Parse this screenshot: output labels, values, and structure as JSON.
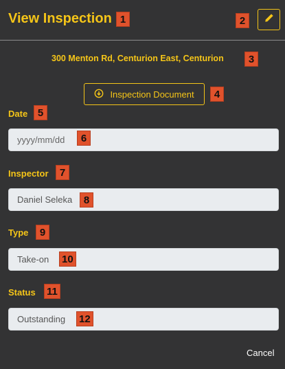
{
  "header": {
    "title": "View Inspection",
    "accent_color": "#F5C518",
    "edit_icon": "pencil-icon"
  },
  "address": "300 Menton Rd, Centurion East, Centurion",
  "inspection_document": {
    "label": "Inspection Document",
    "icon": "download-circle-icon"
  },
  "fields": {
    "date": {
      "label": "Date",
      "value": "",
      "placeholder": "yyyy/mm/dd"
    },
    "inspector": {
      "label": "Inspector",
      "value": "Daniel Seleka"
    },
    "type": {
      "label": "Type",
      "value": "Take-on"
    },
    "status": {
      "label": "Status",
      "value": "Outstanding"
    }
  },
  "footer": {
    "cancel_label": "Cancel"
  },
  "annotations": [
    "1",
    "2",
    "3",
    "4",
    "5",
    "6",
    "7",
    "8",
    "9",
    "10",
    "11",
    "12"
  ]
}
